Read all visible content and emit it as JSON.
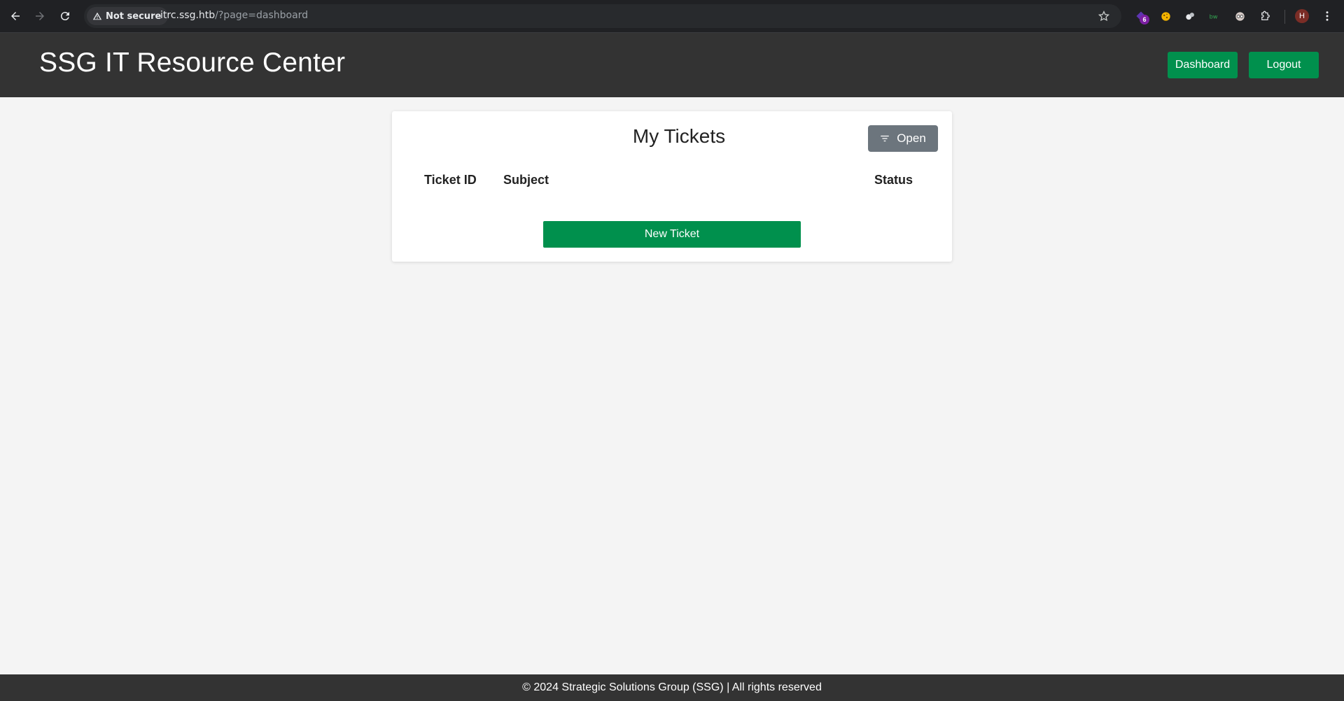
{
  "browser": {
    "security_label": "Not secure",
    "url_host": "itrc.ssg.htb",
    "url_path": "/?page=dashboard",
    "extension_badge": "6",
    "profile_initial": "H"
  },
  "header": {
    "title": "SSG IT Resource Center",
    "dashboard_label": "Dashboard",
    "logout_label": "Logout"
  },
  "tickets": {
    "title": "My Tickets",
    "filter_label": "Open",
    "columns": [
      "Ticket ID",
      "Subject",
      "Status"
    ],
    "rows": [],
    "new_ticket_label": "New Ticket"
  },
  "footer": {
    "text": "© 2024 Strategic Solutions Group (SSG) | All rights reserved"
  },
  "colors": {
    "accent_green": "#00904d",
    "header_bg": "#333333",
    "filter_gray": "#6c757d"
  }
}
